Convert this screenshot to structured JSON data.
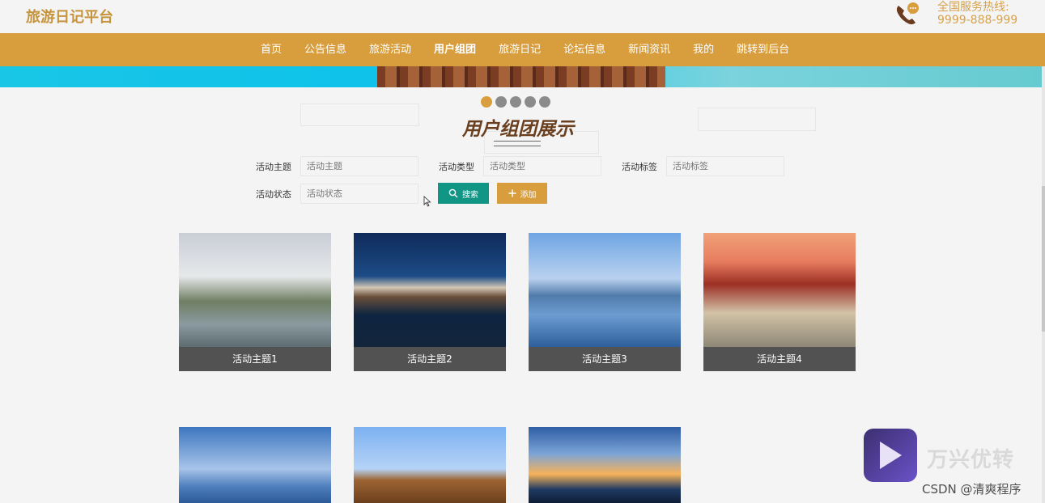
{
  "header": {
    "logo": "旅游日记平台",
    "hotline_label": "全国服务热线:",
    "hotline_number": "9999-888-999"
  },
  "nav": {
    "items": [
      {
        "label": "首页"
      },
      {
        "label": "公告信息"
      },
      {
        "label": "旅游活动"
      },
      {
        "label": "用户组团",
        "active": true
      },
      {
        "label": "旅游日记"
      },
      {
        "label": "论坛信息"
      },
      {
        "label": "新闻资讯"
      },
      {
        "label": "我的"
      },
      {
        "label": "跳转到后台"
      }
    ]
  },
  "section": {
    "title": "用户组团展示",
    "carousel_dots": 5,
    "active_dot": 0
  },
  "filters": {
    "topic": {
      "label": "活动主题",
      "placeholder": "活动主题"
    },
    "type": {
      "label": "活动类型",
      "placeholder": "活动类型"
    },
    "tag": {
      "label": "活动标签",
      "placeholder": "活动标签"
    },
    "status": {
      "label": "活动状态",
      "placeholder": "活动状态"
    },
    "search_button": "搜索",
    "add_button": "添加"
  },
  "cards": [
    {
      "title": "活动主题1"
    },
    {
      "title": "活动主题2"
    },
    {
      "title": "活动主题3"
    },
    {
      "title": "活动主题4"
    }
  ],
  "overlay": {
    "watermark_text": "万兴优转",
    "credit": "CSDN @清爽程序"
  },
  "colors": {
    "accent": "#d89e3d",
    "search_button": "#119686",
    "caption_bg": "#525252",
    "title": "#6a3f1f"
  },
  "icons": {
    "phone": "phone-chat-icon",
    "search": "search-icon",
    "add": "plus-icon"
  }
}
